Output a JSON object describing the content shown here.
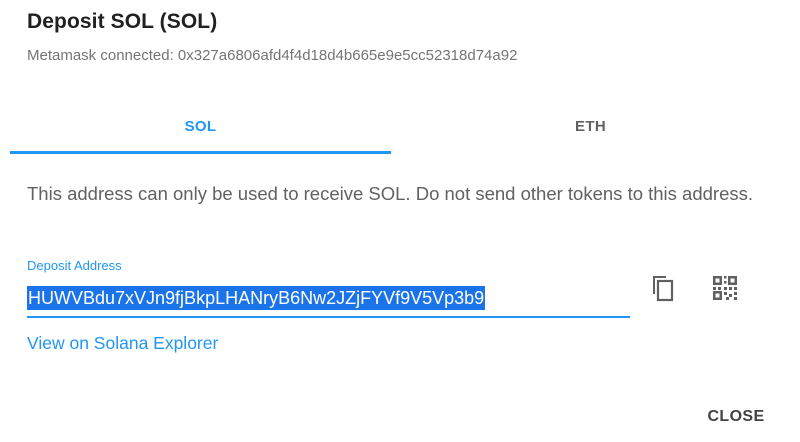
{
  "dialog": {
    "title": "Deposit SOL (SOL)",
    "subtitle": "Metamask connected: 0x327a6806afd4f4d18d4b665e9e5cc52318d74a92"
  },
  "tabs": [
    {
      "label": "SOL",
      "active": true
    },
    {
      "label": "ETH",
      "active": false
    }
  ],
  "info_text": "This address can only be used to receive SOL. Do not send other tokens to this address.",
  "deposit": {
    "label": "Deposit Address",
    "address": "HUWVBdu7xVJn9fjBkpLHANryB6Nw2JZjFYVf9V5Vp3b9",
    "copy_icon": "copy-icon",
    "qr_icon": "qr-code-icon"
  },
  "explorer_link": "View on Solana Explorer",
  "actions": {
    "close_label": "CLOSE"
  },
  "colors": {
    "accent": "#2196f3",
    "selection": "#1a73e8",
    "muted_text": "#757575"
  }
}
